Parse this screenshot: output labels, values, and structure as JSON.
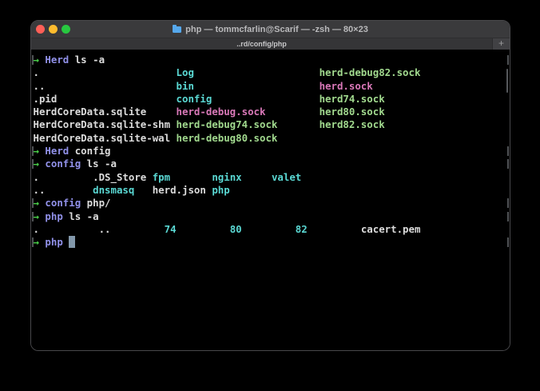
{
  "window": {
    "title": "php — tommcfarlin@Scarif — -zsh — 80×23",
    "tab_label": "..rd/config/php",
    "new_tab_label": "+",
    "folder_icon_color": "#56a8ec",
    "traffic_light_colors": {
      "close": "#ff5f57",
      "minimize": "#febc2e",
      "zoom": "#28c840"
    }
  },
  "terminal": {
    "palette": {
      "foreground": "#dcdcdc",
      "prompt_arrow_green": "#4ad04a",
      "prompt_dir_purple": "#9191e9",
      "directory_cyan": "#5ad8d3",
      "socket_pink": "#d978b8",
      "socket_green": "#a1d98e",
      "cursor_block": "#8398ab",
      "prompt_mark_gray": "#505356"
    },
    "lines": [
      {
        "mark": true,
        "segments": [
          {
            "t": "→ ",
            "c": "green"
          },
          {
            "t": "Herd",
            "c": "purple"
          },
          {
            "t": " ls -a",
            "c": "fg"
          }
        ]
      },
      {
        "segments": [
          {
            "t": ".                       ",
            "c": "fg"
          },
          {
            "t": "Log                     ",
            "c": "cyan"
          },
          {
            "t": "herd-debug82.sock",
            "c": "lime"
          }
        ]
      },
      {
        "segments": [
          {
            "t": "..                      ",
            "c": "fg"
          },
          {
            "t": "bin                     ",
            "c": "cyan"
          },
          {
            "t": "herd.sock",
            "c": "pink"
          }
        ]
      },
      {
        "segments": [
          {
            "t": ".pid                    ",
            "c": "fg"
          },
          {
            "t": "config                  ",
            "c": "cyan"
          },
          {
            "t": "herd74.sock",
            "c": "lime"
          }
        ]
      },
      {
        "segments": [
          {
            "t": "HerdCoreData.sqlite     ",
            "c": "fg"
          },
          {
            "t": "herd-debug.sock         ",
            "c": "pink"
          },
          {
            "t": "herd80.sock",
            "c": "lime"
          }
        ]
      },
      {
        "segments": [
          {
            "t": "HerdCoreData.sqlite-shm ",
            "c": "fg"
          },
          {
            "t": "herd-debug74.sock       ",
            "c": "lime"
          },
          {
            "t": "herd82.sock",
            "c": "lime"
          }
        ]
      },
      {
        "segments": [
          {
            "t": "HerdCoreData.sqlite-wal ",
            "c": "fg"
          },
          {
            "t": "herd-debug80.sock",
            "c": "lime"
          }
        ]
      },
      {
        "mark": true,
        "segments": [
          {
            "t": "→ ",
            "c": "green"
          },
          {
            "t": "Herd",
            "c": "purple"
          },
          {
            "t": " config",
            "c": "fg"
          }
        ]
      },
      {
        "mark": true,
        "segments": [
          {
            "t": "→ ",
            "c": "green"
          },
          {
            "t": "config",
            "c": "purple"
          },
          {
            "t": " ls -a",
            "c": "fg"
          }
        ]
      },
      {
        "segments": [
          {
            "t": ".         ",
            "c": "fg"
          },
          {
            "t": ".DS_Store ",
            "c": "fg"
          },
          {
            "t": "fpm       ",
            "c": "cyan"
          },
          {
            "t": "nginx     ",
            "c": "cyan"
          },
          {
            "t": "valet",
            "c": "cyan"
          }
        ]
      },
      {
        "segments": [
          {
            "t": "..        ",
            "c": "fg"
          },
          {
            "t": "dnsmasq   ",
            "c": "cyan"
          },
          {
            "t": "herd.json ",
            "c": "fg"
          },
          {
            "t": "php",
            "c": "cyan"
          }
        ]
      },
      {
        "mark": true,
        "segments": [
          {
            "t": "→ ",
            "c": "green"
          },
          {
            "t": "config",
            "c": "purple"
          },
          {
            "t": " php/",
            "c": "fg"
          }
        ]
      },
      {
        "mark": true,
        "segments": [
          {
            "t": "→ ",
            "c": "green"
          },
          {
            "t": "php",
            "c": "purple"
          },
          {
            "t": " ls -a",
            "c": "fg"
          }
        ]
      },
      {
        "segments": [
          {
            "t": ".          ",
            "c": "fg"
          },
          {
            "t": "..         ",
            "c": "fg"
          },
          {
            "t": "74         ",
            "c": "cyan"
          },
          {
            "t": "80         ",
            "c": "cyan"
          },
          {
            "t": "82         ",
            "c": "cyan"
          },
          {
            "t": "cacert.pem",
            "c": "fg"
          }
        ]
      },
      {
        "mark": true,
        "segments": [
          {
            "t": "→ ",
            "c": "green"
          },
          {
            "t": "php",
            "c": "purple"
          },
          {
            "t": " ",
            "c": "fg"
          },
          {
            "t": " ",
            "c": "cursor"
          }
        ]
      }
    ]
  }
}
